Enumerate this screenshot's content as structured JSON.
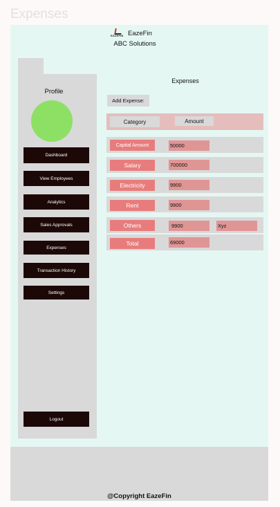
{
  "page_title": "Expenses",
  "brand": {
    "logo_text": "EAZEFIN",
    "name": "EazeFin",
    "company": "ABC Solutions"
  },
  "sidebar": {
    "profile_label": "Profile",
    "items": [
      {
        "label": "Dashboard"
      },
      {
        "label": "View Employees"
      },
      {
        "label": "Analytics"
      },
      {
        "label": "Sales Approvals"
      },
      {
        "label": "Expenses"
      },
      {
        "label": "Transaction History"
      },
      {
        "label": "Settings"
      }
    ],
    "logout": "Logout"
  },
  "main": {
    "title": "Expenses",
    "add_expense": "Add Expense:",
    "headers": {
      "category": "Category",
      "amount": "Amount"
    },
    "rows": [
      {
        "category": "Capital Amount",
        "amount": "50000"
      },
      {
        "category": "Salary",
        "amount": "700000"
      },
      {
        "category": "Electricity",
        "amount": "9900"
      },
      {
        "category": "Rent",
        "amount": "9900"
      },
      {
        "category": "Others",
        "amount": "9900",
        "note": "Xyz"
      },
      {
        "category": "Total",
        "amount": "69000"
      }
    ]
  },
  "footer": {
    "copyright": "@Copyright EazeFin"
  },
  "colors": {
    "accent": "#e87c7c",
    "nav_bg": "#1c0807",
    "avatar": "#8ee065",
    "frame_bg": "#e5f7f3"
  }
}
